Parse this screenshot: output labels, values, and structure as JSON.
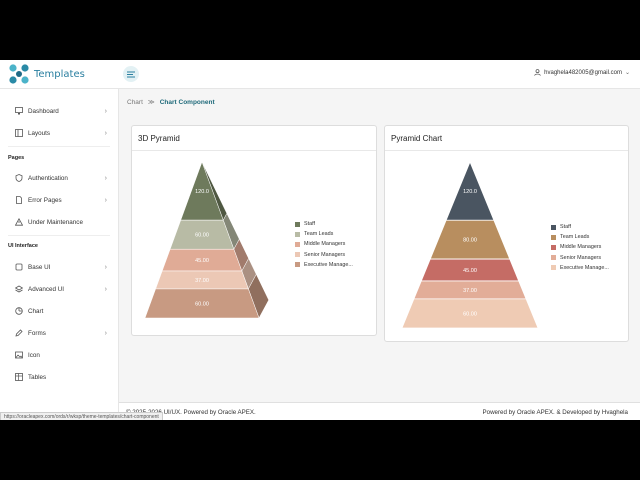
{
  "app": {
    "brand": "Templates",
    "user_email": "hvaghela482005@gmail.com"
  },
  "sidebar": {
    "items": [
      {
        "label": "Dashboard",
        "icon": "monitor-icon",
        "chevron": true
      },
      {
        "label": "Layouts",
        "icon": "layout-icon",
        "chevron": true
      },
      {
        "label": "Authentication",
        "icon": "shield-icon",
        "chevron": true
      },
      {
        "label": "Error Pages",
        "icon": "file-icon",
        "chevron": true
      },
      {
        "label": "Under Maintenance",
        "icon": "warning-icon",
        "chevron": false
      },
      {
        "label": "Base UI",
        "icon": "box-icon",
        "chevron": true
      },
      {
        "label": "Advanced UI",
        "icon": "layers-icon",
        "chevron": true
      },
      {
        "label": "Chart",
        "icon": "pie-chart-icon",
        "chevron": false
      },
      {
        "label": "Forms",
        "icon": "pen-icon",
        "chevron": true
      },
      {
        "label": "Icon",
        "icon": "image-icon",
        "chevron": false
      },
      {
        "label": "Tables",
        "icon": "table-icon",
        "chevron": false
      }
    ],
    "sections": {
      "pages": "Pages",
      "ui_interface": "UI Interface"
    }
  },
  "breadcrumb": {
    "root": "Chart",
    "separator": "≫",
    "current": "Chart Component"
  },
  "cards": {
    "left_title": "3D Pyramid",
    "right_title": "Pyramid Chart"
  },
  "chart_data": [
    {
      "type": "pyramid-3d",
      "title": "3D Pyramid",
      "categories": [
        "Staff",
        "Team Leads",
        "Middle Managers",
        "Senior Managers",
        "Executive Manage..."
      ],
      "values": [
        120,
        60,
        45,
        37,
        60
      ],
      "labels": [
        "120.0",
        "60.00",
        "45.00",
        "37.00",
        "60.00"
      ],
      "colors": [
        "#6e7a5c",
        "#b8bba5",
        "#e0ab96",
        "#ecc8b5",
        "#c89a82"
      ]
    },
    {
      "type": "pyramid",
      "title": "Pyramid Chart",
      "categories": [
        "Staff",
        "Team Leads",
        "Middle Managers",
        "Senior Managers",
        "Executive Manage..."
      ],
      "values": [
        120,
        80,
        45,
        37,
        60
      ],
      "labels": [
        "120.0",
        "80.00",
        "45.00",
        "37.00",
        "60.00"
      ],
      "colors": [
        "#4a5561",
        "#b88e5f",
        "#c56c65",
        "#e2ad98",
        "#efcbb4"
      ]
    }
  ],
  "footer": {
    "left": "© 2025-2026 UI/UX. Powered by Oracle APEX.",
    "right": "Powered by Oracle APEX. & Developed by Hvaghela"
  },
  "status_bar": {
    "url": "https://oracleapex.com/ords/r/wksp/theme-templates/chart-component"
  }
}
